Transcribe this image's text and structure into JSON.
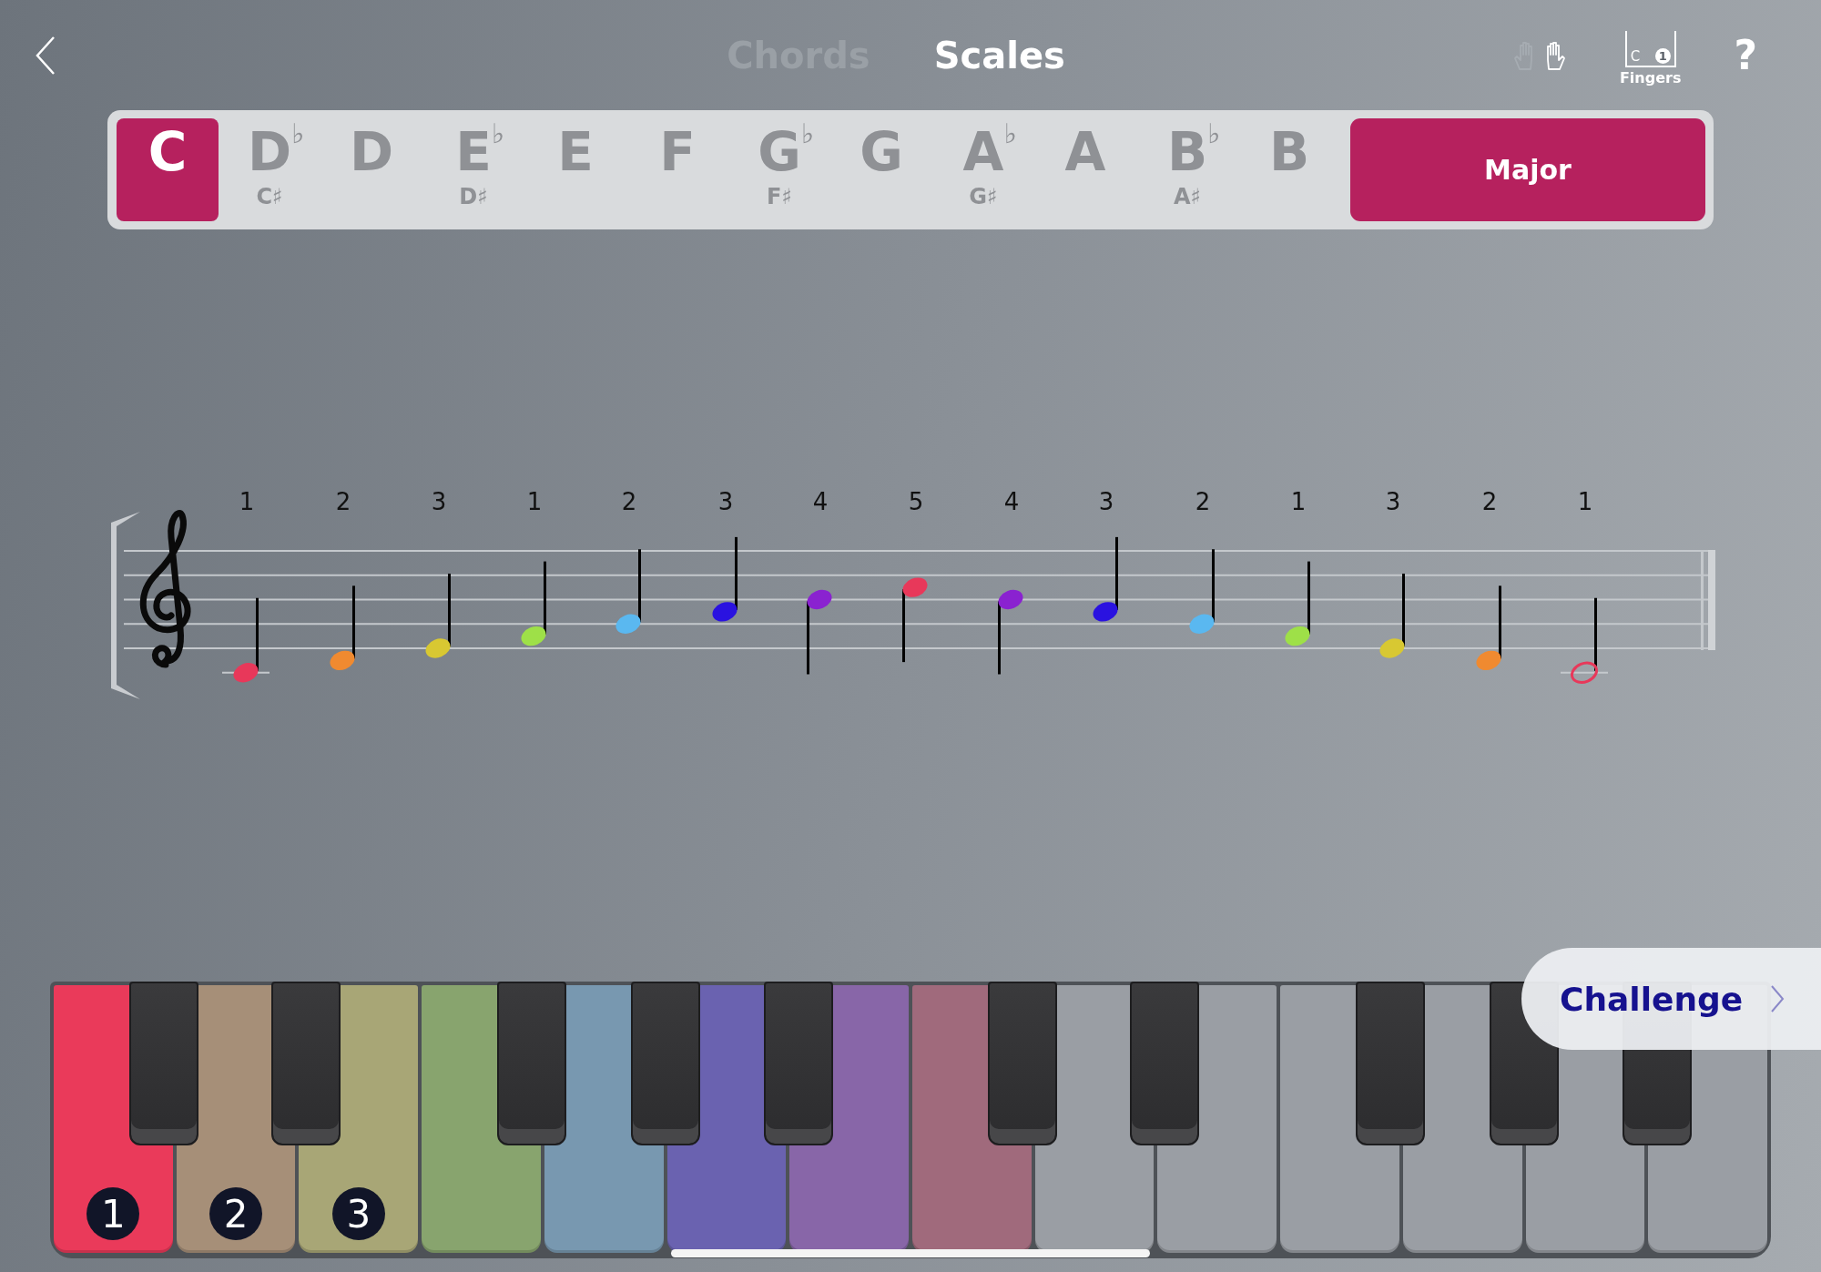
{
  "top_bar": {
    "tabs": [
      {
        "label": "Chords",
        "selected": false
      },
      {
        "label": "Scales",
        "selected": true
      }
    ],
    "hands": [
      {
        "selected": false
      },
      {
        "selected": true
      }
    ],
    "fingers": {
      "label": "Fingers",
      "key_letter": "C",
      "finger": "1"
    },
    "help": "?"
  },
  "key_picker": {
    "keys": [
      {
        "name": "C",
        "selected": true
      },
      {
        "name": "D",
        "flat": "♭",
        "enharmonic": "C♯",
        "selected": false
      },
      {
        "name": "D",
        "selected": false
      },
      {
        "name": "E",
        "flat": "♭",
        "enharmonic": "D♯",
        "selected": false
      },
      {
        "name": "E",
        "selected": false
      },
      {
        "name": "F",
        "selected": false
      },
      {
        "name": "G",
        "flat": "♭",
        "enharmonic": "F♯",
        "selected": false
      },
      {
        "name": "G",
        "selected": false
      },
      {
        "name": "A",
        "flat": "♭",
        "enharmonic": "G♯",
        "selected": false
      },
      {
        "name": "A",
        "selected": false
      },
      {
        "name": "B",
        "flat": "♭",
        "enharmonic": "A♯",
        "selected": false
      },
      {
        "name": "B",
        "selected": false
      }
    ],
    "scale_type": "Major"
  },
  "staff": {
    "notes": [
      {
        "finger": "1",
        "color": "#e8385a",
        "filled": true
      },
      {
        "finger": "2",
        "color": "#f08a30",
        "filled": true
      },
      {
        "finger": "3",
        "color": "#d8c832",
        "filled": true
      },
      {
        "finger": "1",
        "color": "#9ee048",
        "filled": true
      },
      {
        "finger": "2",
        "color": "#5ab8f0",
        "filled": true
      },
      {
        "finger": "3",
        "color": "#2a12e0",
        "filled": true
      },
      {
        "finger": "4",
        "color": "#8a22d0",
        "filled": true
      },
      {
        "finger": "5",
        "color": "#e8385a",
        "filled": true
      },
      {
        "finger": "4",
        "color": "#8a22d0",
        "filled": true
      },
      {
        "finger": "3",
        "color": "#2a12e0",
        "filled": true
      },
      {
        "finger": "2",
        "color": "#5ab8f0",
        "filled": true
      },
      {
        "finger": "1",
        "color": "#9ee048",
        "filled": true
      },
      {
        "finger": "3",
        "color": "#d8c832",
        "filled": true
      },
      {
        "finger": "2",
        "color": "#f08a30",
        "filled": true
      },
      {
        "finger": "1",
        "color": "#e8385a",
        "filled": false
      }
    ]
  },
  "keyboard": {
    "white_keys": [
      {
        "color": "#ea3a5a",
        "finger": "1"
      },
      {
        "color": "#a68f78",
        "finger": "2"
      },
      {
        "color": "#a8a676",
        "finger": "3"
      },
      {
        "color": "#88a46e"
      },
      {
        "color": "#7898b0"
      },
      {
        "color": "#6a62b0"
      },
      {
        "color": "#8866a8"
      },
      {
        "color": "#a06a7c"
      },
      {
        "color": "#9a9ea4"
      },
      {
        "color": "#9a9ea4"
      },
      {
        "color": "#9a9ea4"
      },
      {
        "color": "#9a9ea4"
      },
      {
        "color": "#9a9ea4"
      },
      {
        "color": "#9a9ea4"
      }
    ],
    "challenge_button": "Challenge"
  }
}
